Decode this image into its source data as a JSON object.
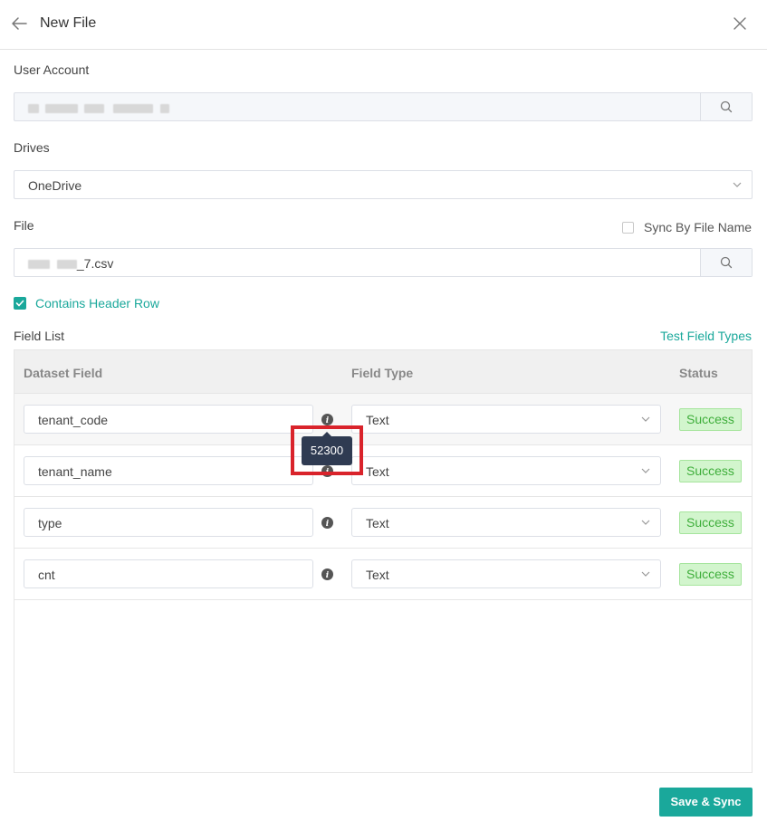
{
  "header": {
    "title": "New File"
  },
  "form": {
    "user_account_label": "User Account",
    "drives_label": "Drives",
    "drive_value": "OneDrive",
    "file_label": "File",
    "file_value_suffix": "_7.csv",
    "sync_by_file_name_label": "Sync By File Name",
    "sync_by_file_name_checked": false,
    "contains_header_row_label": "Contains Header Row",
    "contains_header_row_checked": true
  },
  "field_list": {
    "label": "Field List",
    "test_link": "Test Field Types",
    "columns": [
      "Dataset Field",
      "Field Type",
      "Status"
    ],
    "rows": [
      {
        "field": "tenant_code",
        "type": "Text",
        "status": "Success"
      },
      {
        "field": "tenant_name",
        "type": "Text",
        "status": "Success"
      },
      {
        "field": "type",
        "type": "Text",
        "status": "Success"
      },
      {
        "field": "cnt",
        "type": "Text",
        "status": "Success"
      }
    ]
  },
  "tooltip": {
    "text": "52300"
  },
  "footer": {
    "save_label": "Save & Sync"
  },
  "colors": {
    "accent": "#1aa89b",
    "success_bg": "#d2f5cd",
    "success_text": "#3fae3b",
    "tooltip_bg": "#2f3b52",
    "highlight": "#d9232b"
  }
}
